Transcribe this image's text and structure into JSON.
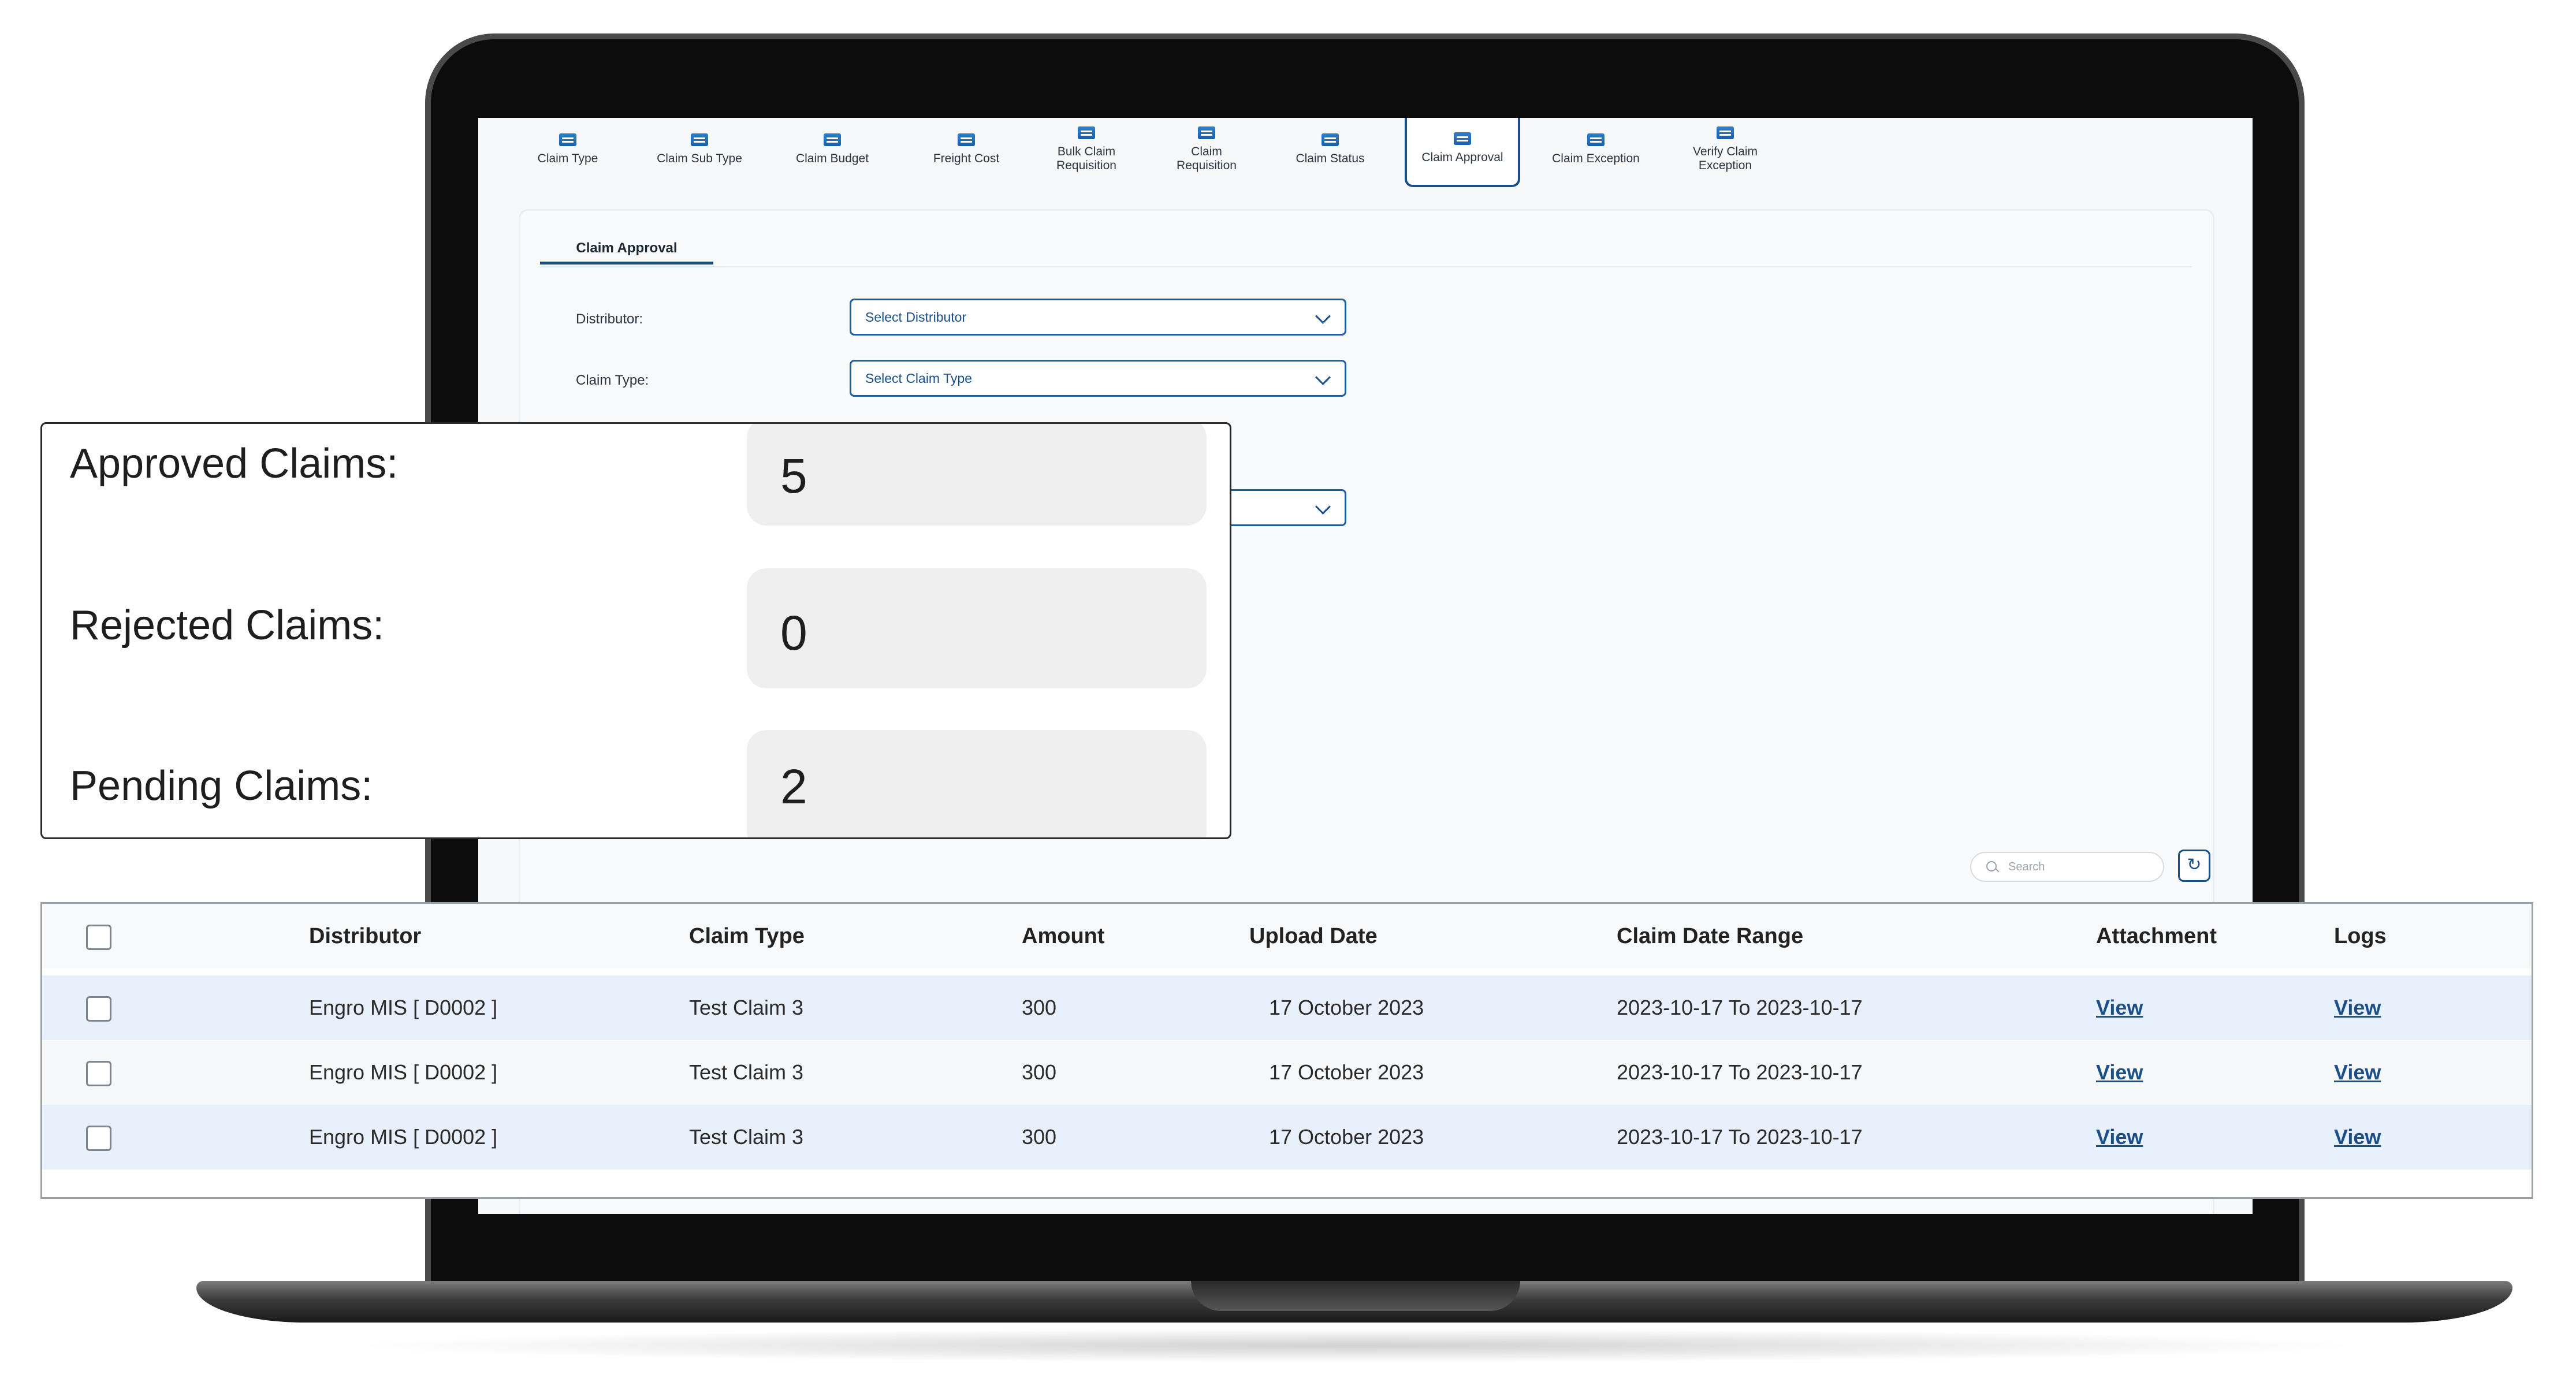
{
  "toolbar": {
    "items": [
      {
        "label": "Claim Type",
        "icon": "claim-type-icon"
      },
      {
        "label": "Claim Sub Type",
        "icon": "claim-sub-type-icon"
      },
      {
        "label": "Claim Budget",
        "icon": "claim-budget-icon"
      },
      {
        "label": "Freight Cost",
        "icon": "truck-icon"
      },
      {
        "label": "Bulk Claim Requisition",
        "icon": "bulk-claim-icon"
      },
      {
        "label": "Claim Requisition",
        "icon": "claim-requisition-icon"
      },
      {
        "label": "Claim Status",
        "icon": "claim-status-icon"
      },
      {
        "label": "Claim Approval",
        "icon": "claim-approval-icon",
        "active": true
      },
      {
        "label": "Claim Exception",
        "icon": "claim-exception-icon"
      },
      {
        "label": "Verify Claim Exception",
        "icon": "verify-claim-icon"
      }
    ]
  },
  "panel": {
    "tab_label": "Claim Approval",
    "distributor": {
      "label": "Distributor:",
      "placeholder": "Select Distributor"
    },
    "claim_type": {
      "label": "Claim Type:",
      "placeholder": "Select Claim Type"
    },
    "search_placeholder": "Search",
    "refresh_icon": "refresh-icon"
  },
  "summary": {
    "approved": {
      "label": "Approved Claims:",
      "value": "5"
    },
    "rejected": {
      "label": "Rejected Claims:",
      "value": "0"
    },
    "pending": {
      "label": "Pending Claims:",
      "value": "2"
    }
  },
  "table": {
    "headers": [
      "Distributor",
      "Claim Type",
      "Amount",
      "Upload Date",
      "Claim Date Range",
      "Attachment",
      "Logs"
    ],
    "rows": [
      {
        "distributor": "Engro MIS [ D0002 ]",
        "claim_type": "Test Claim 3",
        "amount": "300",
        "upload_date": "17 October 2023",
        "date_range": "2023-10-17 To 2023-10-17",
        "attachment": "View",
        "logs": "View"
      },
      {
        "distributor": "Engro MIS [ D0002 ]",
        "claim_type": "Test Claim 3",
        "amount": "300",
        "upload_date": "17 October 2023",
        "date_range": "2023-10-17 To 2023-10-17",
        "attachment": "View",
        "logs": "View"
      },
      {
        "distributor": "Engro MIS [ D0002 ]",
        "claim_type": "Test Claim 3",
        "amount": "300",
        "upload_date": "17 October 2023",
        "date_range": "2023-10-17 To 2023-10-17",
        "attachment": "View",
        "logs": "View"
      }
    ]
  }
}
